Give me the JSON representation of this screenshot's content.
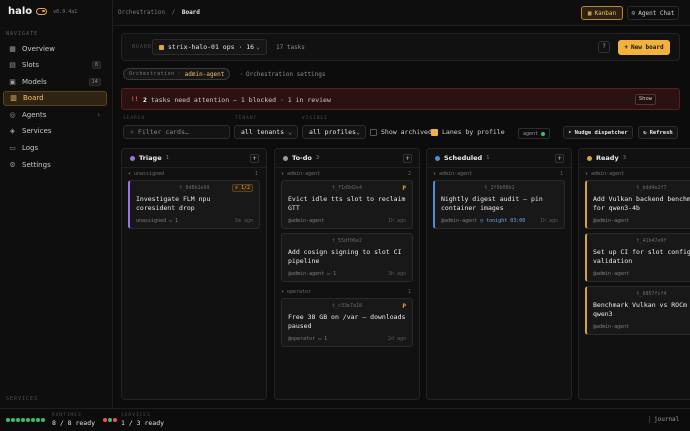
{
  "brand": {
    "name": "halo",
    "version": "v0.9.4a1"
  },
  "sidebar": {
    "section_label": "Navigate",
    "items": [
      {
        "label": "Overview",
        "icon": "grid-icon"
      },
      {
        "label": "Slots",
        "icon": "slots-icon",
        "badge": "8"
      },
      {
        "label": "Models",
        "icon": "box-icon",
        "badge": "14"
      },
      {
        "label": "Board",
        "icon": "board-icon",
        "active": true
      },
      {
        "label": "Agents",
        "icon": "agent-icon",
        "expandable": true
      },
      {
        "label": "Services",
        "icon": "services-icon"
      },
      {
        "label": "Logs",
        "icon": "logs-icon"
      },
      {
        "label": "Settings",
        "icon": "gear-icon"
      }
    ],
    "services_label": "Services"
  },
  "topbar": {
    "breadcrumb_parent": "Orchestration",
    "breadcrumb_sep": "/",
    "breadcrumb_current": "Board",
    "kanban_label": "Kanban",
    "agent_chat_label": "Agent Chat"
  },
  "board": {
    "label": "Board",
    "selected": "strix-halo-01 ops · 16",
    "task_count": "17 tasks",
    "help": "?",
    "new_board_label": "New board"
  },
  "tabs": {
    "orch_prefix": "Orchestration ·",
    "orch_agent": "admin-agent",
    "settings_label": "Orchestration settings"
  },
  "alert": {
    "icon": "!!",
    "count": "2",
    "text": "tasks need attention — 1 blocked · 1 in review",
    "show_label": "Show"
  },
  "filters": {
    "search_label": "Search",
    "search_placeholder": "Filter cards…",
    "tenant_label": "Tenant",
    "tenant_value": "all tenants",
    "visible_label": "Visible",
    "profile_value": "all profiles",
    "show_archived_label": "Show archived",
    "show_archived": false,
    "lanes_label": "Lanes by profile",
    "lanes_by_profile": true,
    "agent_pill": "agent",
    "nudge_label": "Nudge dispatcher",
    "refresh_label": "Refresh"
  },
  "columns": [
    {
      "title": "Triage",
      "count": "1",
      "dot": "#9a74e0",
      "accent": "lb-purple",
      "groups": [
        {
          "name": "unassigned",
          "count": "1",
          "cards": [
            {
              "id": "t_8d8b1e99",
              "title": "Investigate FLM npu coresident drop",
              "assignee": "unassigned",
              "comments": "1",
              "age": "5m ago",
              "tag": "1/2"
            }
          ]
        }
      ]
    },
    {
      "title": "To-do",
      "count": "3",
      "dot": "#9a9a9a",
      "accent": "",
      "groups": [
        {
          "name": "admin-agent",
          "count": "2",
          "cards": [
            {
              "id": "t_f1d9d2e4",
              "title": "Evict idle tts slot to reclaim GTT",
              "assignee": "@admin-agent",
              "comments": "",
              "age": "1h ago",
              "prio": "P"
            },
            {
              "id": "t_55df06e2",
              "title": "Add cosign signing to slot CI pipeline",
              "assignee": "@admin-agent",
              "comments": "1",
              "age": "3h ago"
            }
          ]
        },
        {
          "name": "operator",
          "count": "1",
          "cards": [
            {
              "id": "t_c33e7a18",
              "title": "Free 38 GB on /var — downloads paused",
              "assignee": "@operator",
              "comments": "1",
              "age": "2d ago",
              "prio": "P"
            }
          ]
        }
      ]
    },
    {
      "title": "Scheduled",
      "count": "1",
      "dot": "#4d8fd6",
      "accent": "lb-blue",
      "groups": [
        {
          "name": "admin-agent",
          "count": "1",
          "cards": [
            {
              "id": "t_2f9b08b1",
              "title": "Nightly digest audit — pin container images",
              "assignee": "@admin-agent",
              "schedule": "tonight 03:00",
              "age": "1h ago"
            }
          ]
        }
      ]
    },
    {
      "title": "Ready",
      "count": "3",
      "dot": "#d8a13a",
      "accent": "lb-amber",
      "groups": [
        {
          "name": "admin-agent",
          "count": "3",
          "cards": [
            {
              "id": "t_bdd4e2f7",
              "title": "Add Vulkan backend benchmarks for qwen3-4b",
              "assignee": "@admin-agent",
              "age": "",
              "comments": ""
            },
            {
              "id": "t_41b47e9f",
              "title": "Set up CI for slot config validation",
              "assignee": "@admin-agent",
              "age": "",
              "comments": ""
            },
            {
              "id": "t_8857fcf4",
              "title": "Benchmark Vulkan vs ROCm on qwen3",
              "assignee": "@admin-agent",
              "age": "",
              "comments": ""
            }
          ]
        }
      ]
    }
  ],
  "footer": {
    "runtimes_label": "Runtimes",
    "runtimes_value": "8 / 8 ready",
    "runtimes_dots": [
      "#35c26b",
      "#35c26b",
      "#35c26b",
      "#35c26b",
      "#35c26b",
      "#35c26b",
      "#35c26b",
      "#35c26b"
    ],
    "services_label": "Services",
    "services_value": "1 / 3 ready",
    "services_dots": [
      "#ff4d4d",
      "#35c26b",
      "#ff4d4d"
    ],
    "journal_label": "journal"
  }
}
